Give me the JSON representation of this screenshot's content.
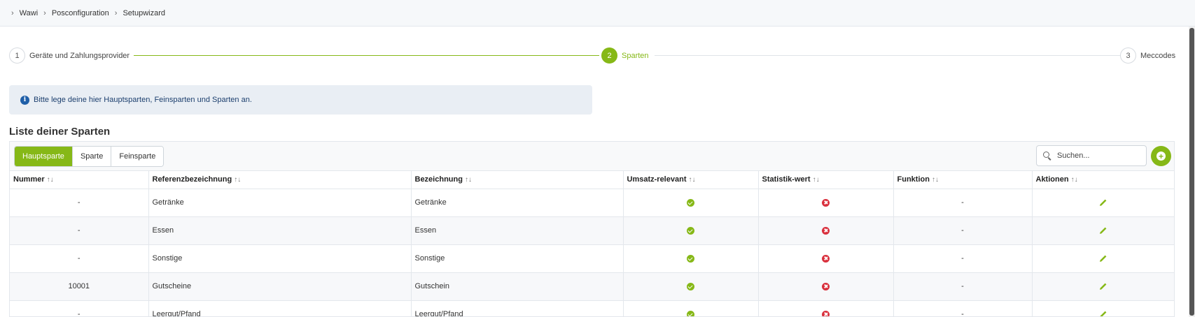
{
  "breadcrumb": [
    "Wawi",
    "Posconfiguration",
    "Setupwizard"
  ],
  "steps": [
    {
      "number": "1",
      "label": "Geräte und Zahlungsprovider"
    },
    {
      "number": "2",
      "label": "Sparten"
    },
    {
      "number": "3",
      "label": "Meccodes"
    }
  ],
  "active_step": 2,
  "info": {
    "text": "Bitte lege deine hier Hauptsparten, Feinsparten und Sparten an.",
    "icon": "info-icon"
  },
  "title": "Liste deiner Sparten",
  "tabs": [
    "Hauptsparte",
    "Sparte",
    "Feinsparte"
  ],
  "active_tab": "Hauptsparte",
  "search": {
    "placeholder": "Suchen...",
    "value": ""
  },
  "add_button": {
    "icon": "plus-circle-icon"
  },
  "columns": [
    "Nummer",
    "Referenzbezeichnung",
    "Bezeichnung",
    "Umsatz-relevant",
    "Statistik-wert",
    "Funktion",
    "Aktionen"
  ],
  "rows": [
    {
      "nummer": "-",
      "referenz": "Getränke",
      "bezeichnung": "Getränke",
      "umsatz": true,
      "statistik": false,
      "funktion": "-"
    },
    {
      "nummer": "-",
      "referenz": "Essen",
      "bezeichnung": "Essen",
      "umsatz": true,
      "statistik": false,
      "funktion": "-"
    },
    {
      "nummer": "-",
      "referenz": "Sonstige",
      "bezeichnung": "Sonstige",
      "umsatz": true,
      "statistik": false,
      "funktion": "-"
    },
    {
      "nummer": "10001",
      "referenz": "Gutscheine",
      "bezeichnung": "Gutschein",
      "umsatz": true,
      "statistik": false,
      "funktion": "-"
    },
    {
      "nummer": "-",
      "referenz": "Leergut/Pfand",
      "bezeichnung": "Leergut/Pfand",
      "umsatz": true,
      "statistik": false,
      "funktion": "-"
    }
  ],
  "colors": {
    "accent": "#86b817",
    "danger": "#d9303d",
    "info_bg": "#e9eef4"
  }
}
